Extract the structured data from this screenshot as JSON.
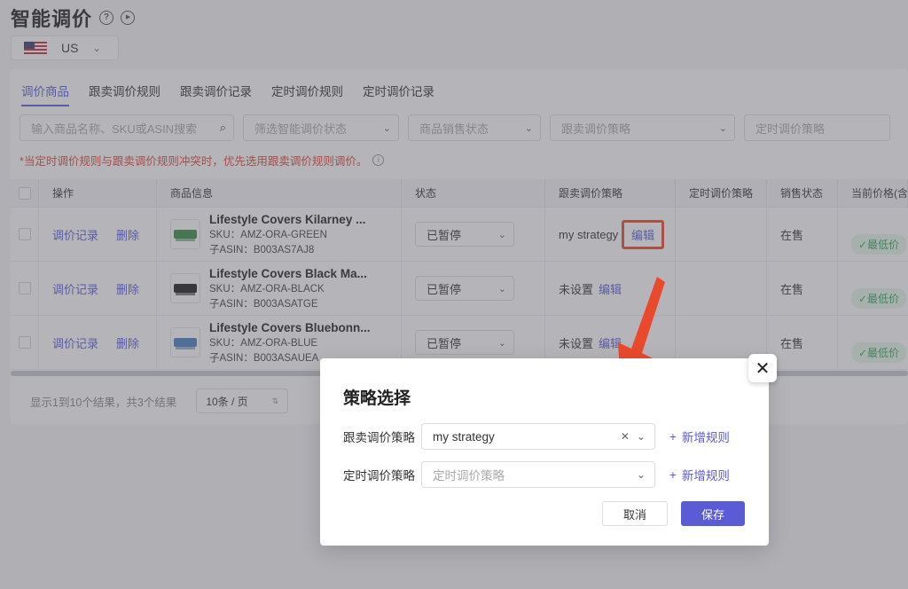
{
  "header": {
    "title": "智能调价",
    "help_icon": "?",
    "play_icon": "▶"
  },
  "market": {
    "value": "US",
    "flag": "us-flag-icon"
  },
  "tabs": [
    {
      "label": "调价商品",
      "active": true
    },
    {
      "label": "跟卖调价规则",
      "active": false
    },
    {
      "label": "跟卖调价记录",
      "active": false
    },
    {
      "label": "定时调价规则",
      "active": false
    },
    {
      "label": "定时调价记录",
      "active": false
    }
  ],
  "filters": {
    "search_placeholder": "输入商品名称、SKU或ASIN搜索",
    "smart_status": "筛选智能调价状态",
    "sale_status": "商品销售状态",
    "follow_strategy": "跟卖调价策略",
    "timed_strategy": "定时调价策略"
  },
  "notice": "*当定时调价规则与跟卖调价规则冲突时，优先选用跟卖调价规则调价。",
  "table": {
    "headers": {
      "op": "操作",
      "product": "商品信息",
      "status": "状态",
      "follow": "跟卖调价策略",
      "timed": "定时调价策略",
      "sale": "销售状态",
      "price": "当前价格(含"
    },
    "op_labels": {
      "record": "调价记录",
      "delete": "删除",
      "edit": "编辑"
    },
    "rows": [
      {
        "name": "Lifestyle Covers Kilarney ...",
        "sku": "SKU：AMZ-ORA-GREEN",
        "asin": "子ASIN：B003AS7AJ8",
        "status": "已暂停",
        "follow": "my strategy",
        "sale": "在售",
        "price": "✓最低价",
        "color": "#3c8a4a"
      },
      {
        "name": "Lifestyle Covers Black Ma...",
        "sku": "SKU：AMZ-ORA-BLACK",
        "asin": "子ASIN：B003ASATGE",
        "status": "已暂停",
        "follow": "未设置",
        "sale": "在售",
        "price": "✓最低价",
        "color": "#1c1c1c"
      },
      {
        "name": "Lifestyle Covers Bluebonn...",
        "sku": "SKU：AMZ-ORA-BLUE",
        "asin": "子ASIN：B003ASAUEA",
        "status": "已暂停",
        "follow": "未设置",
        "sale": "在售",
        "price": "✓最低价",
        "color": "#4a7fc0"
      }
    ]
  },
  "pagination": {
    "summary": "显示1到10个结果，共3个结果",
    "page_size": "10条 / 页"
  },
  "modal": {
    "title": "策略选择",
    "follow_label": "跟卖调价策略",
    "follow_value": "my strategy",
    "timed_label": "定时调价策略",
    "timed_placeholder": "定时调价策略",
    "add_rule": "新增规则",
    "cancel": "取消",
    "save": "保存"
  },
  "colors": {
    "accent": "#5b5bd6",
    "highlight": "#e94a2e",
    "warning_text": "#e0443a"
  }
}
